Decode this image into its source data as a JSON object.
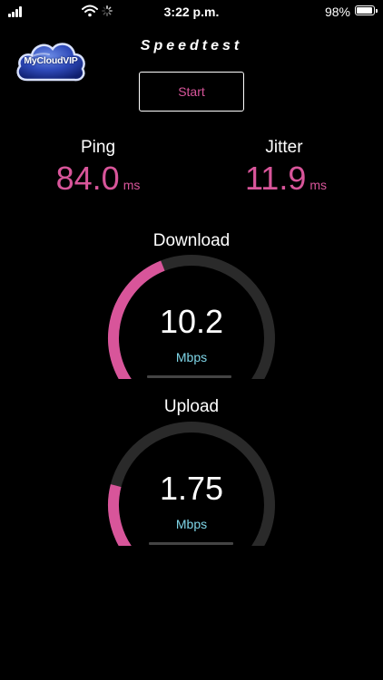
{
  "status_bar": {
    "time": "3:22 p.m.",
    "battery_percent": "98%",
    "battery_level": 0.98
  },
  "logo": {
    "text": "MyCloudVIP"
  },
  "app": {
    "title": "Speedtest"
  },
  "start_button": {
    "label": "Start"
  },
  "ping": {
    "label": "Ping",
    "value": "84.0",
    "unit": "ms"
  },
  "jitter": {
    "label": "Jitter",
    "value": "11.9",
    "unit": "ms"
  },
  "download": {
    "title": "Download",
    "value": "10.2",
    "unit": "Mbps",
    "fraction": 0.42
  },
  "upload": {
    "title": "Upload",
    "value": "1.75",
    "unit": "Mbps",
    "fraction": 0.22
  },
  "colors": {
    "accent_pink": "#d8559a",
    "unit_cyan": "#7fd6e8",
    "gauge_track": "#2a2a2a",
    "background": "#000000"
  }
}
